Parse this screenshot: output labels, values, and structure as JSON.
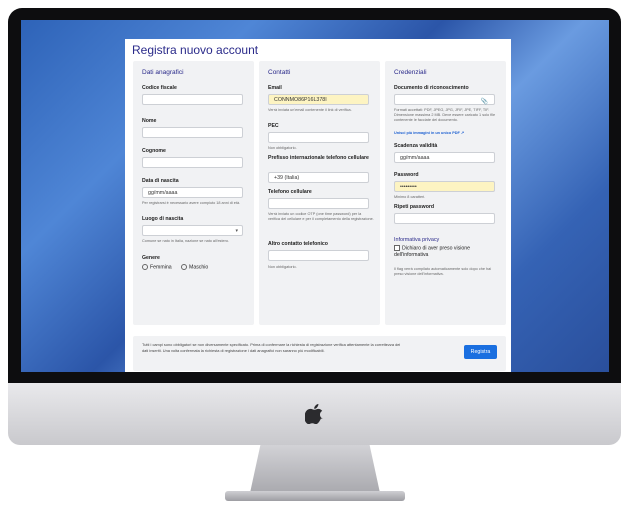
{
  "form": {
    "title": "Registra nuovo account",
    "submit_label": "Registra",
    "footer_text": "Tutti i campi sono obbligatori se non diversamente specificato. Prima di confermare la richiesta di registrazione verifica attentamente la correttezza dei dati inseriti. Una volta confermata la richiesta di registrazione i dati anagrafici non saranno più modificabili."
  },
  "anagrafici": {
    "heading": "Dati anagrafici",
    "codice_fiscale_label": "Codice fiscale",
    "nome_label": "Nome",
    "cognome_label": "Cognome",
    "data_nascita_label": "Data di nascita",
    "data_nascita_placeholder": "gg/mm/aaaa",
    "data_nascita_help": "Per registrarsi è necessario avere compiuto 18 anni di età.",
    "luogo_nascita_label": "Luogo di nascita",
    "luogo_nascita_help": "Comune se nato in Italia, nazione se nato all'estero.",
    "genere_label": "Genere",
    "genere_options": [
      "Femmina",
      "Maschio"
    ]
  },
  "contatti": {
    "heading": "Contatti",
    "email_label": "Email",
    "email_value": "CONNMO86P16L378I",
    "email_help": "Verrà inviata un'email contenente il link di verifica.",
    "pec_label": "PEC",
    "pec_help": "Non obbligatorio.",
    "prefisso_label": "Prefisso internazionale telefono cellulare",
    "prefisso_value": "+39 (Italia)",
    "telefono_label": "Telefono cellulare",
    "telefono_help": "Verrà inviato un codice OTP (one time password) per la verifica del cellulare e per il completamento della registrazione.",
    "altro_label": "Altro contatto telefonico",
    "altro_help": "Non obbligatorio."
  },
  "credenziali": {
    "heading": "Credenziali",
    "documento_label": "Documento di riconoscimento",
    "documento_help": "Formati accettati: PDF, JPEG, JPG, JFIF, JPE, TIFF, TIF. Dimensione massima 2 MB. Deve essere caricato 1 solo file contenente le facciate del documento.",
    "documento_link": "Unisci più immagini in un unico PDF",
    "scadenza_label": "Scadenza validità",
    "scadenza_placeholder": "gg/mm/aaaa",
    "password_label": "Password",
    "password_value": "•••••••••",
    "password_help": "Minimo 8 caratteri.",
    "ripeti_label": "Ripeti password",
    "privacy_heading": "Informativa privacy",
    "privacy_check": "Dichiaro di aver preso visione dell'informativa",
    "privacy_help": "Il flag verrà compilato automaticamente solo dopo che hai preso visione dell'informativa."
  },
  "icons": {
    "paperclip": "paperclip-icon",
    "external_link": "external-link-icon",
    "chevron": "chevron-down-icon",
    "apple": "apple-logo"
  }
}
